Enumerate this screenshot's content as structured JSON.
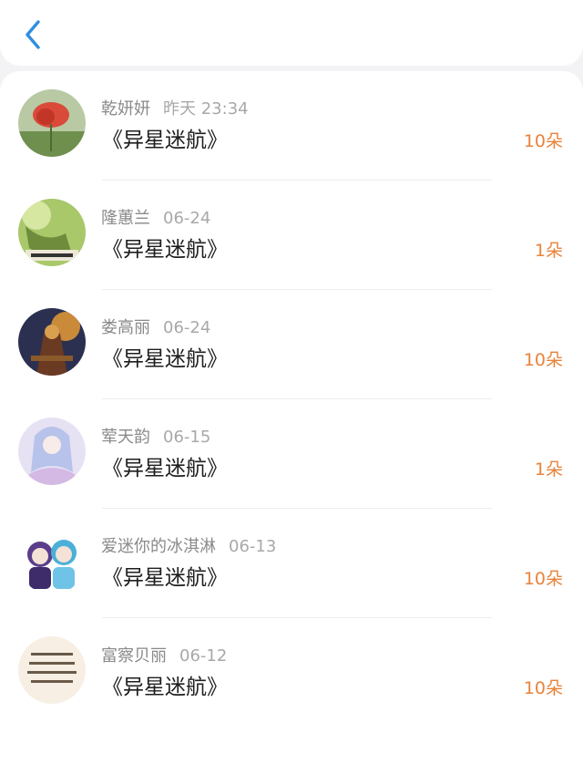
{
  "header": {
    "back_icon": "chevron-left-icon"
  },
  "colors": {
    "accent": "#e8833a",
    "back": "#2f8ee0"
  },
  "rows": [
    {
      "name": "乾妍妍",
      "time": "昨天 23:34",
      "title": "《异星迷航》",
      "amount": "10朵"
    },
    {
      "name": "隆蕙兰",
      "time": "06-24",
      "title": "《异星迷航》",
      "amount": "1朵"
    },
    {
      "name": "娄高丽",
      "time": "06-24",
      "title": "《异星迷航》",
      "amount": "10朵"
    },
    {
      "name": "荤天韵",
      "time": "06-15",
      "title": "《异星迷航》",
      "amount": "1朵"
    },
    {
      "name": "爱迷你的冰淇淋",
      "time": "06-13",
      "title": "《异星迷航》",
      "amount": "10朵"
    },
    {
      "name": "富察贝丽",
      "time": "06-12",
      "title": "《异星迷航》",
      "amount": "10朵"
    }
  ]
}
